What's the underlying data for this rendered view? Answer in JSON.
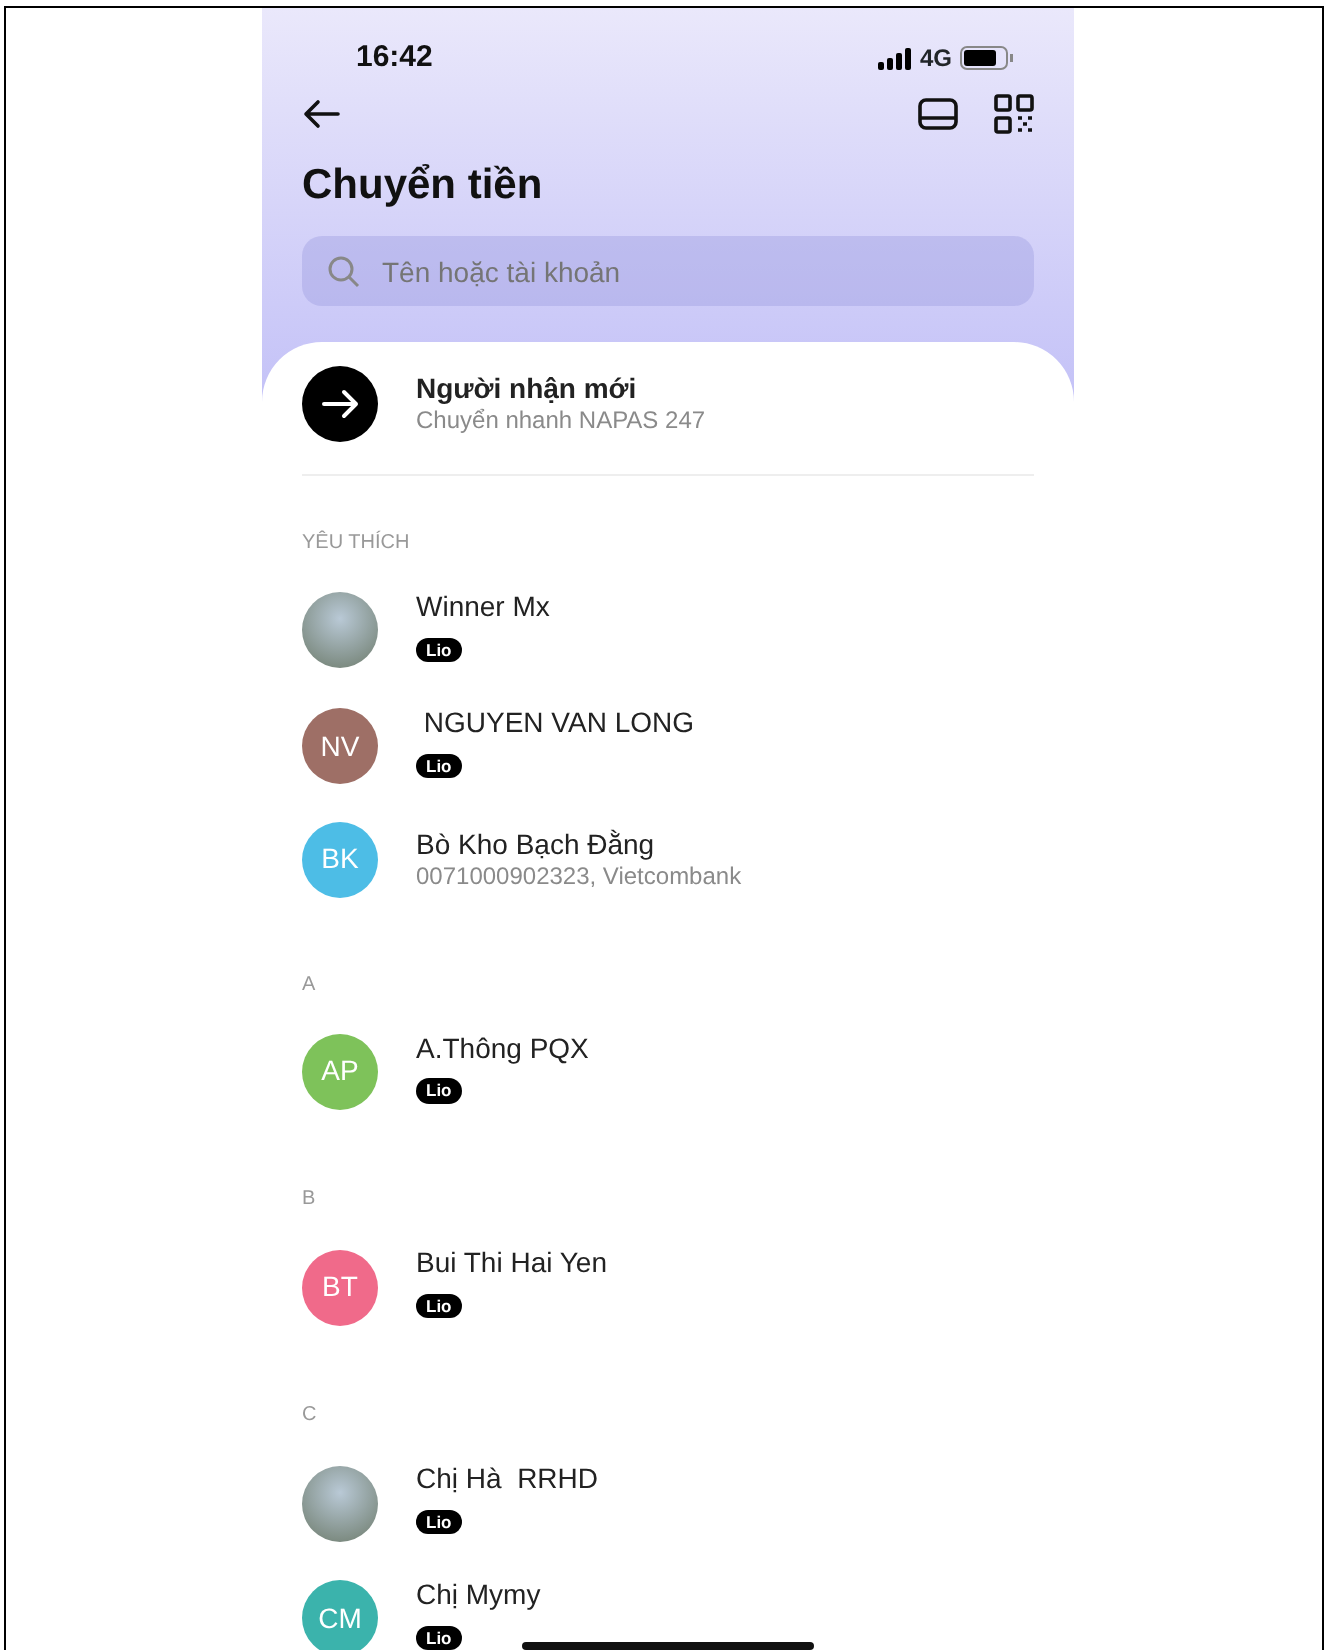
{
  "status_bar": {
    "time": "16:42",
    "network": "4G"
  },
  "header": {
    "title": "Chuyển tiền",
    "search": {
      "placeholder": "Tên hoặc tài khoản"
    }
  },
  "new_recipient": {
    "title": "Người nhận mới",
    "subtitle": "Chuyển nhanh NAPAS 247"
  },
  "sections": [
    {
      "header": "YÊU THÍCH",
      "contacts": [
        {
          "kind": "photo",
          "name": "Winner Mx",
          "tag": "Lio"
        },
        {
          "kind": "initials",
          "initials": "NV",
          "color": "#9e6f66",
          "name": " NGUYEN VAN LONG",
          "tag": "Lio"
        },
        {
          "kind": "initials",
          "initials": "BK",
          "color": "#4dbde6",
          "name": "Bò Kho Bạch Đằng",
          "subtitle": "0071000902323, Vietcombank"
        }
      ]
    },
    {
      "header": "A",
      "contacts": [
        {
          "kind": "initials",
          "initials": "AP",
          "color": "#7ec25a",
          "name": "A.Thông PQX",
          "tag": "Lio"
        }
      ]
    },
    {
      "header": "B",
      "contacts": [
        {
          "kind": "initials",
          "initials": "BT",
          "color": "#f06a8a",
          "name": "Bui Thi Hai Yen",
          "tag": "Lio"
        }
      ]
    },
    {
      "header": "C",
      "contacts": [
        {
          "kind": "photo",
          "name": "Chị Hà  RRHD",
          "tag": "Lio"
        },
        {
          "kind": "initials",
          "initials": "CM",
          "color": "#3bb3ac",
          "name": "Chị Mymy",
          "tag": "Lio"
        }
      ]
    }
  ]
}
